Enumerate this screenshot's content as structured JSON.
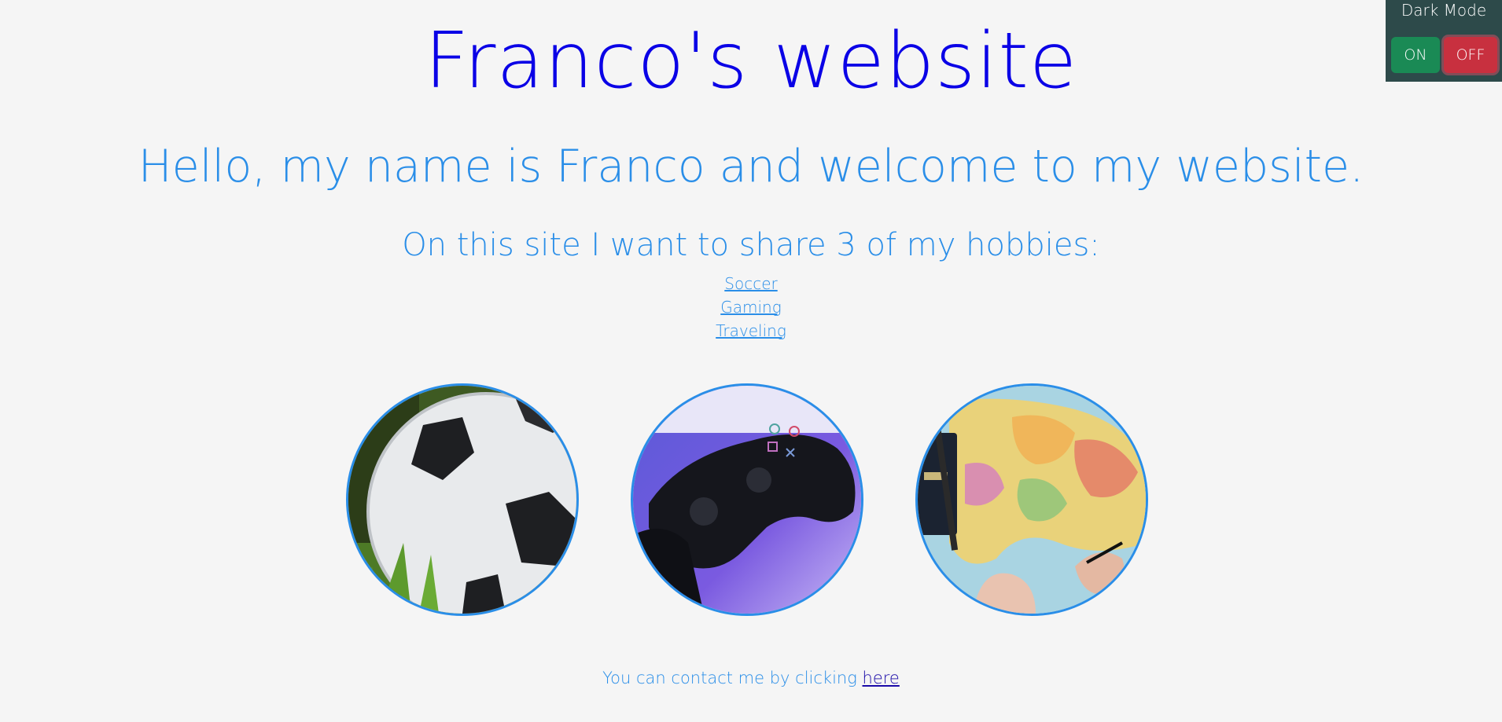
{
  "header": {
    "title": "Franco's website",
    "greeting": "Hello, my name is Franco and welcome to my website.",
    "subtitle": "On this site I want to share 3 of my hobbies:"
  },
  "hobbies": {
    "links": [
      "Soccer",
      "Gaming",
      "Traveling"
    ]
  },
  "photos": [
    {
      "name": "soccer-ball-photo"
    },
    {
      "name": "game-controller-photo"
    },
    {
      "name": "world-map-photo"
    }
  ],
  "contact": {
    "text": "You can contact me by clicking",
    "link_text": "here"
  },
  "dark_mode": {
    "label": "Dark Mode",
    "on_label": "ON",
    "off_label": "OFF",
    "state": "OFF"
  },
  "colors": {
    "title": "#0a00e6",
    "accent": "#2a8ee8",
    "background": "#f5f5f5",
    "panel": "#2d4a4a",
    "on_button": "#1a8a55",
    "off_button": "#c8303f"
  }
}
